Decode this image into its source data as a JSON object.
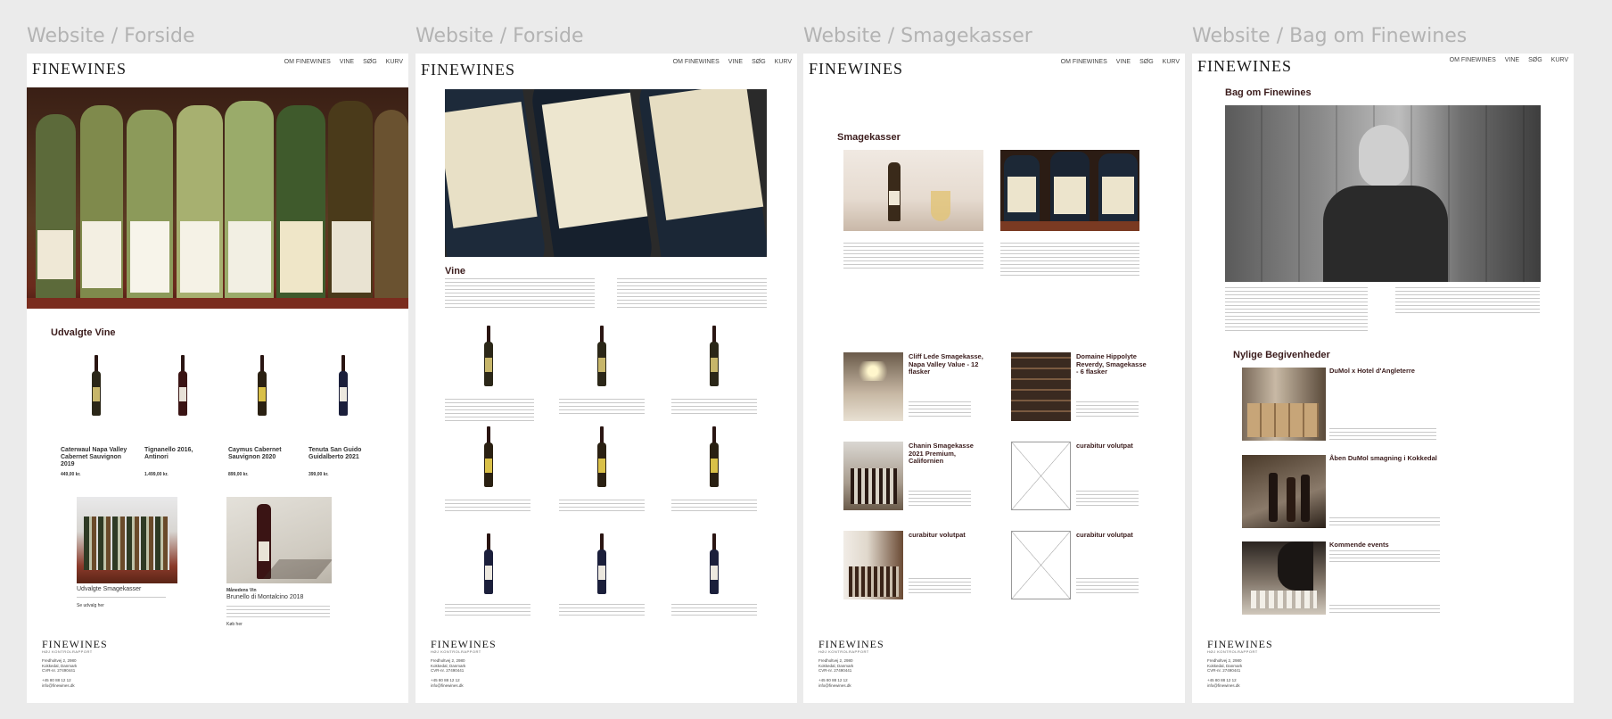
{
  "frames": [
    {
      "title": "Website / Forside"
    },
    {
      "title": "Website / Forside"
    },
    {
      "title": "Website / Smagekasser"
    },
    {
      "title": "Website / Bag om Finewines"
    }
  ],
  "brand": {
    "logo": "FINEWINES",
    "footer_logo": "FINEWINES",
    "footer_sub": "HØJ KONTROLRAPPORT",
    "address": [
      "Fredholtvej 2, 2980",
      "Kokkedal, Danmark",
      "CVR-nr. 27490441"
    ],
    "contact": [
      "+45 80 88 12 12",
      "info@finewines.dk"
    ]
  },
  "nav": [
    "OM FINEWINES",
    "VINE",
    "SØG",
    "KURV"
  ],
  "frame1": {
    "section_title": "Udvalgte Vine",
    "wines": [
      {
        "name": "Caterwaul Napa Valley Cabernet Sauvignon 2019",
        "price": "449,00 kr."
      },
      {
        "name": "Tignanello 2016, Antinori",
        "price": "1.499,00 kr."
      },
      {
        "name": "Caymus Cabernet Sauvignon 2020",
        "price": "899,00 kr."
      },
      {
        "name": "Tenuta San Guido Guidalberto 2021",
        "price": "399,00 kr."
      }
    ],
    "promo_left_title": "Udvalgte Smagekasser",
    "promo_left_link": "Se udvalg her",
    "promo_right_kicker": "Månedens Vin",
    "promo_right_title": "Brunello di Montalcino 2018",
    "promo_right_link": "Køb her"
  },
  "frame2": {
    "section_title": "Vine"
  },
  "frame3": {
    "section_title": "Smagekasser",
    "boxes": [
      {
        "name": "Cliff Lede Smagekasse, Napa Valley Value - 12 flasker"
      },
      {
        "name": "Domaine Hippolyte Reverdy, Smagekasse - 6 flasker"
      },
      {
        "name": "Chanin Smagekasse 2021 Premium, Californien"
      },
      {
        "name": "curabitur volutpat"
      },
      {
        "name": "curabitur volutpat"
      },
      {
        "name": "curabitur volutpat"
      }
    ]
  },
  "frame4": {
    "section_title": "Bag om Finewines",
    "events_title": "Nylige Begivenheder",
    "events": [
      {
        "name": "DuMol x Hotel d'Angleterre"
      },
      {
        "name": "Åben DuMol smagning i Kokkedal"
      },
      {
        "name": "Kommende events"
      }
    ]
  },
  "colors": {
    "accent_text": "#3b1c1c",
    "frame_title": "#b3b3b3",
    "canvas": "#ebebeb"
  }
}
